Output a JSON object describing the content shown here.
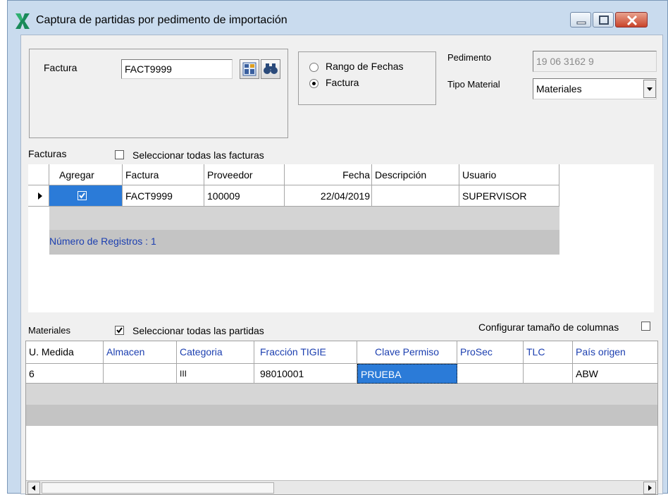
{
  "window": {
    "title": "Captura de partidas por pedimento de importación"
  },
  "filters": {
    "factura_label": "Factura",
    "factura_value": "FACT9999",
    "radio_group": {
      "options": [
        {
          "label": "Rango de Fechas",
          "selected": false
        },
        {
          "label": "Factura",
          "selected": true
        }
      ]
    },
    "pedimento_label": "Pedimento",
    "pedimento_value": "19 06 3162 9",
    "tipo_material_label": "Tipo Material",
    "tipo_material_value": "Materiales"
  },
  "facturas": {
    "section_label": "Facturas",
    "select_all_label": "Seleccionar todas las facturas",
    "select_all_checked": false,
    "columns": [
      "Agregar",
      "Factura",
      "Proveedor",
      "Fecha",
      "Descripción",
      "Usuario"
    ],
    "rows": [
      {
        "agregar": true,
        "factura": "FACT9999",
        "proveedor": "100009",
        "fecha": "22/04/2019",
        "descripcion": "",
        "usuario": "SUPERVISOR"
      }
    ],
    "record_count": "Número de Registros : 1"
  },
  "materiales": {
    "section_label": "Materiales",
    "select_all_label": "Seleccionar todas las partidas",
    "select_all_checked": true,
    "configure_label": "Configurar tamaño de columnas",
    "configure_checked": false,
    "columns": [
      "U. Medida",
      "Almacen",
      "Categoria",
      "Fracción TIGIE",
      "Clave Permiso",
      "ProSec",
      "TLC",
      "País origen"
    ],
    "rows": [
      {
        "u_medida": "6",
        "almacen": "",
        "categoria": "III",
        "fraccion": "98010001",
        "clave_permiso": "PRUEBA",
        "prosec": "",
        "tlc": "",
        "pais_origen": "ABW"
      }
    ]
  },
  "icons": {
    "app": "x-logo-icon",
    "calc": "calculator-icon",
    "search": "binoculars-icon"
  },
  "colors": {
    "selection": "#2b7bd8",
    "link_blue": "#1c3fb0",
    "title_bg": "#c9dbee",
    "close_btn": "#c9442a"
  }
}
